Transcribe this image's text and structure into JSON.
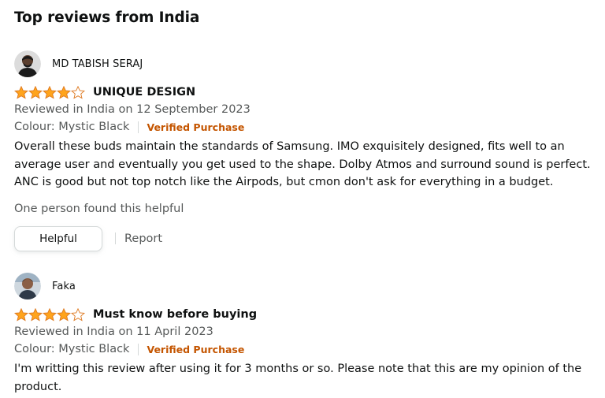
{
  "section": {
    "title": "Top reviews from India"
  },
  "colors": {
    "star": "#ffa41c",
    "star_outline": "#de7921",
    "verified": "#c45500",
    "muted_text": "#565959",
    "text": "#0f1111"
  },
  "reviews": [
    {
      "profile_name": "MD TABISH SERAJ",
      "avatar_icon": "user-avatar-photo",
      "rating": 4,
      "rating_out_of": 5,
      "title": "UNIQUE DESIGN",
      "date_text": "Reviewed in India on 12 September 2023",
      "variant": "Colour: Mystic Black",
      "verified_label": "Verified Purchase",
      "body": "Overall these buds maintain the standards of Samsung. IMO exquisitely designed, fits well to an average user and eventually you get used to the shape. Dolby Atmos and surround sound is perfect. ANC is good but not top notch like the Airpods, but cmon don't ask for everything in a budget.",
      "helpful_count_text": "One person found this helpful",
      "helpful_button_label": "Helpful",
      "report_label": "Report"
    },
    {
      "profile_name": "Faka",
      "avatar_icon": "user-avatar-photo",
      "rating": 4,
      "rating_out_of": 5,
      "title": "Must know before buying",
      "date_text": "Reviewed in India on 11 April 2023",
      "variant": "Colour: Mystic Black",
      "verified_label": "Verified Purchase",
      "body": "I'm writting this review after using it for 3 months or so. Please note that this are my opinion of the product."
    }
  ]
}
